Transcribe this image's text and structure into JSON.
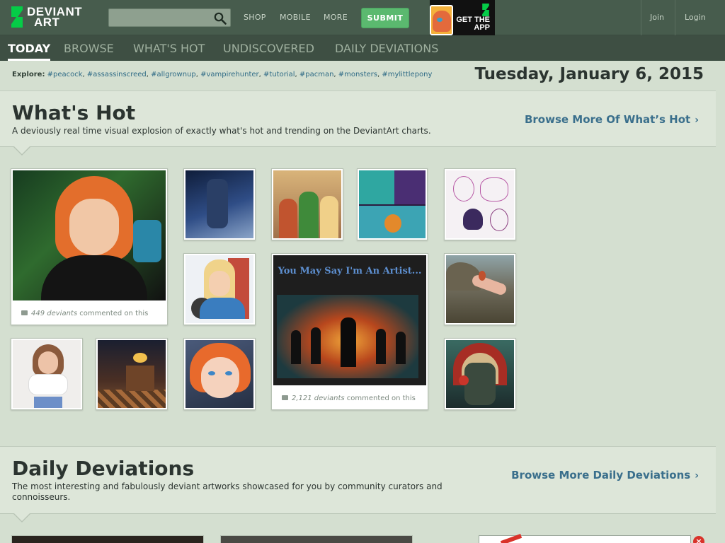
{
  "header": {
    "logo_line1": "DEVIANT",
    "logo_line2": "ART",
    "search_placeholder": "",
    "nav": {
      "shop": "SHOP",
      "mobile": "MOBILE",
      "more": "MORE"
    },
    "submit_label": "SUBMIT",
    "app_promo": "GET THE APP",
    "join": "Join",
    "login": "Login"
  },
  "tabs": [
    {
      "label": "TODAY",
      "active": true
    },
    {
      "label": "BROWSE"
    },
    {
      "label": "WHAT'S HOT"
    },
    {
      "label": "UNDISCOVERED"
    },
    {
      "label": "DAILY DEVIATIONS"
    }
  ],
  "explore": {
    "label": "Explore:",
    "tags": [
      "#peacock",
      "#assassinscreed",
      "#allgrownup",
      "#vampirehunter",
      "#tutorial",
      "#pacman",
      "#monsters",
      "#mylittlepony"
    ]
  },
  "date": "Tuesday, January 6, 2015",
  "whats_hot": {
    "title": "What's Hot",
    "description": "A deviously real time visual explosion of exactly what's hot and trending on the DeviantArt charts.",
    "browse_more": "Browse More Of What’s Hot",
    "card1_count": "449 deviants",
    "card1_suffix": "commented on this",
    "card2_title": "You May Say I'm An Artist...",
    "card2_count": "2,121 deviants",
    "card2_suffix": "commented on this"
  },
  "daily_deviations": {
    "title": "Daily Deviations",
    "description": "The most interesting and fabulously deviant artworks showcased for you by community curators and connoisseurs.",
    "browse_more": "Browse More Daily Deviations"
  },
  "colors": {
    "topbar": "#475c4d",
    "tabbar": "#3e4f43",
    "background": "#d4dfd0",
    "submit": "#5bb96f",
    "link": "#3a6f8c"
  }
}
